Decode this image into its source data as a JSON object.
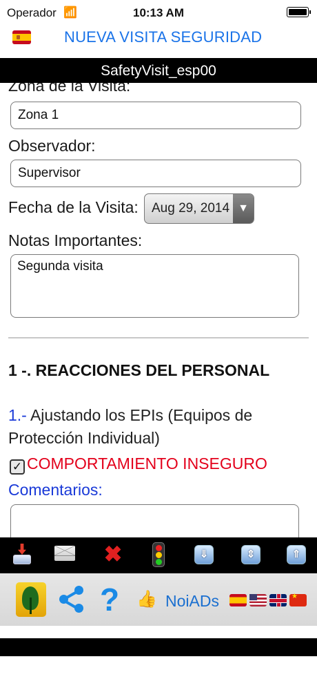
{
  "status_bar": {
    "carrier": "Operador",
    "time": "10:13 AM",
    "wifi_icon": "wifi-icon",
    "battery_icon": "battery-icon"
  },
  "nav": {
    "title": "NUEVA VISITA SEGURIDAD",
    "flag_icon": "spain-flag-icon"
  },
  "banner": {
    "title": "SafetyVisit_esp00"
  },
  "form": {
    "zona_label": "Zona de la Visita:",
    "zona_value": "Zona 1",
    "observador_label": "Observador:",
    "observador_value": "Supervisor",
    "fecha_label": "Fecha de la Visita:",
    "fecha_value": "Aug 29, 2014",
    "dropdown_arrow": "▼",
    "notas_label": "Notas Importantes:",
    "notas_value": "Segunda visita"
  },
  "section": {
    "title": "1 -. REACCIONES DEL PERSONAL",
    "question_number": "1.-",
    "question_text": " Ajustando los EPIs (Equipos de Protección Individual)",
    "checkbox_mark": "✓",
    "status": "COMPORTAMIENTO INSEGURO",
    "comments_label": "Comentarios:"
  },
  "toolbar": {
    "icons": [
      "save-download-icon",
      "mail-icon",
      "close-icon",
      "traffic-light-icon",
      "scroll-down-icon",
      "scroll-both-icon",
      "scroll-up-icon"
    ],
    "close_glyph": "✖",
    "down_glyph": "⇓",
    "both_glyph": "⇕",
    "up_glyph": "⇑"
  },
  "ad_bar": {
    "help_glyph": "?",
    "thumb_glyph": "👍",
    "noiads_label": "NoiADs",
    "flag_icons": [
      "spain-flag-icon",
      "usa-flag-icon",
      "uk-flag-icon",
      "china-flag-icon"
    ]
  },
  "colors": {
    "accent_blue": "#1a73e8",
    "question_blue": "#1a3ad8",
    "unsafe_red": "#e3001b",
    "banner_black": "#000000"
  }
}
